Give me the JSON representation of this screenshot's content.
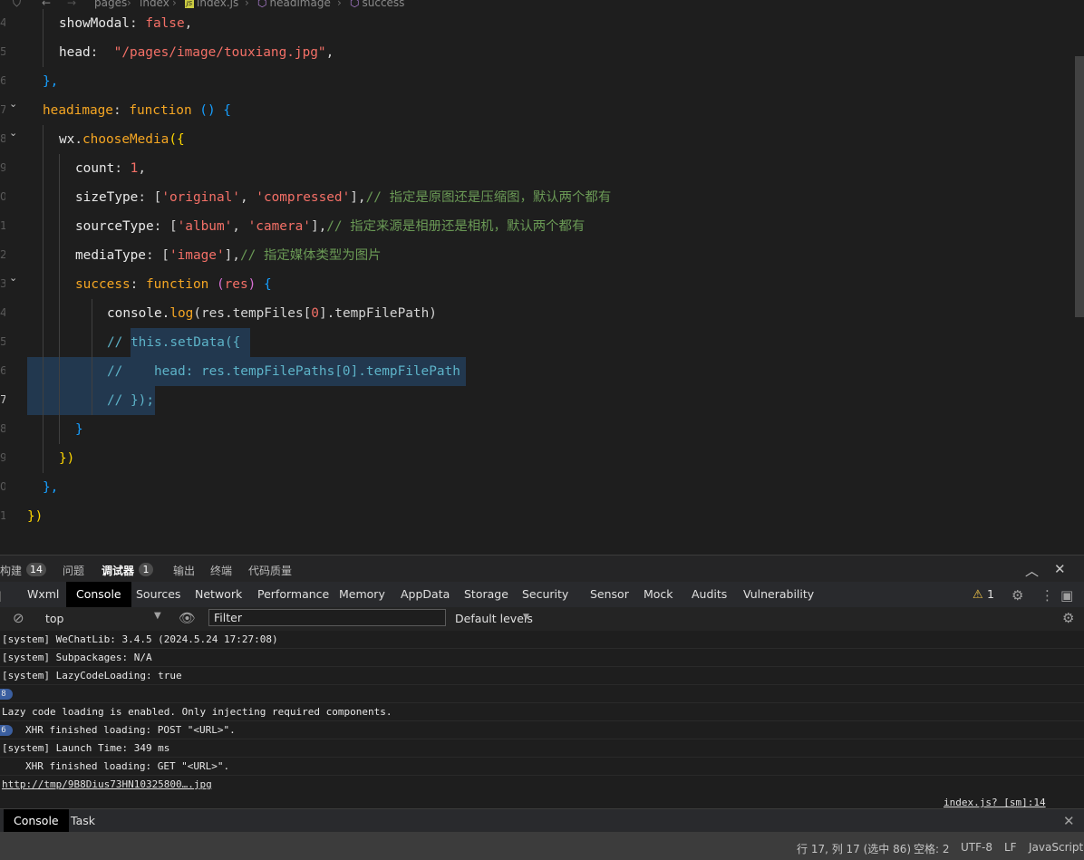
{
  "breadcrumb": [
    "pages",
    "index",
    "index.js",
    "headimage",
    "success"
  ],
  "line_numbers": [
    "4",
    "5",
    "6",
    "7",
    "8",
    "9",
    "0",
    "1",
    "2",
    "3",
    "4",
    "5",
    "6",
    "7",
    "8",
    "9",
    "0",
    "1"
  ],
  "code": {
    "l1": {
      "key": "showModal",
      "colon": ": ",
      "val": "false",
      "end": ","
    },
    "l2": {
      "key": "head",
      "colon": ":  ",
      "val": "\"/pages/image/touxiang.jpg\"",
      "end": ","
    },
    "l3": {
      "text": "},"
    },
    "l4": {
      "name": "headimage",
      "colon": ": ",
      "kw": "function",
      "rest": " () {"
    },
    "l5": {
      "obj": "wx",
      "dot": ".",
      "method": "chooseMedia",
      "rest": "({"
    },
    "l6": {
      "key": "count",
      "colon": ": ",
      "val": "1",
      "end": ","
    },
    "l7": {
      "key": "sizeType",
      "colon": ": [",
      "s1": "'original'",
      "sep": ", ",
      "s2": "'compressed'",
      "end": "],",
      "comment": "// 指定是原图还是压缩图，默认两个都有"
    },
    "l8": {
      "key": "sourceType",
      "colon": ": [",
      "s1": "'album'",
      "sep": ", ",
      "s2": "'camera'",
      "end": "],",
      "comment": "// 指定来源是相册还是相机，默认两个都有"
    },
    "l9": {
      "key": "mediaType",
      "colon": ": [",
      "s1": "'image'",
      "end": "],",
      "comment": "// 指定媒体类型为图片"
    },
    "l10": {
      "name": "success",
      "colon": ": ",
      "kw": "function",
      "param_open": " (",
      "param": "res",
      "param_close": ")",
      "rest": " {"
    },
    "l11": {
      "a": "console.",
      "method": "log",
      "b": "(res.tempFiles[",
      "num": "0",
      "c": "].tempFilePath)"
    },
    "l12": {
      "slash": "// ",
      "text": "this.setData({"
    },
    "l13": {
      "slash": "//",
      "text": "    head: res.tempFilePaths[0].tempFilePath"
    },
    "l14": {
      "slash": "// ",
      "text": "});"
    },
    "l15": {
      "text": "}"
    },
    "l16": {
      "text": "})"
    },
    "l17": {
      "text": "},"
    },
    "l18": {
      "text": "})"
    }
  },
  "panel": {
    "tabs": [
      {
        "label": "构建",
        "badge": "14"
      },
      {
        "label": "问题"
      },
      {
        "label": "调试器",
        "badge": "1"
      },
      {
        "label": "输出"
      },
      {
        "label": "终端"
      },
      {
        "label": "代码质量"
      }
    ],
    "maximize_icon": "chevron-up-icon",
    "close_icon": "close-icon"
  },
  "devtools": {
    "tabs": [
      "Wxml",
      "Console",
      "Sources",
      "Network",
      "Performance",
      "Memory",
      "AppData",
      "Storage",
      "Security",
      "Sensor",
      "Mock",
      "Audits",
      "Vulnerability"
    ],
    "active": "Console",
    "warning_count": "1"
  },
  "console_toolbar": {
    "context": "top",
    "filter_placeholder": "Filter",
    "levels": "Default levels"
  },
  "console_lines": [
    {
      "text": "[system] WeChatLib: 3.4.5 (2024.5.24 17:27:08)"
    },
    {
      "text": "[system] Subpackages: N/A"
    },
    {
      "text": "[system] LazyCodeLoading: true"
    },
    {
      "count": "8",
      "text": "XHR finished loading: POST \"<URL>\"."
    },
    {
      "text": "Lazy code loading is enabled. Only injecting required components."
    },
    {
      "count": "6",
      "text": "XHR finished loading: GET \"<URL>\"."
    },
    {
      "text": "[system] Launch Time: 349 ms"
    },
    {
      "link": "http://tmp/9B8Dius73HN10325800….jpg",
      "source": "index.js? [sm]:14"
    }
  ],
  "drawer": {
    "tabs": [
      "Console",
      "Task"
    ]
  },
  "status_bar": {
    "position": "行 17, 列 17 (选中 86)",
    "indent": "空格: 2",
    "encoding": "UTF-8",
    "eol": "LF",
    "language": "JavaScript"
  }
}
